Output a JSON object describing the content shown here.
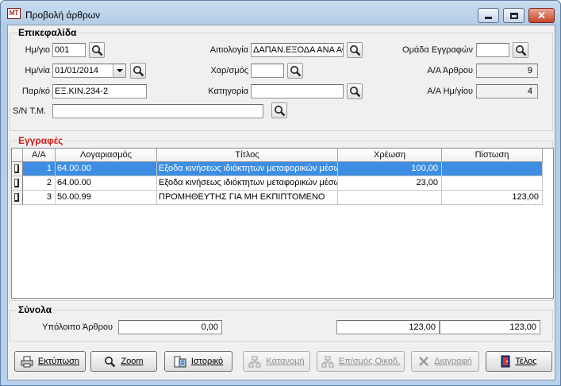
{
  "window": {
    "title": "Προβολή άρθρων",
    "app_icon_text": "ΜΤ"
  },
  "header_group": {
    "label": "Επικεφαλίδα",
    "date_label": "Ημ/γιο",
    "date_value": "001",
    "date2_label": "Ημ/νία",
    "date2_value": "01/01/2014",
    "doc_label": "Παρ/κό",
    "doc_value": "ΕΞ.ΚΙΝ.234-2",
    "serial_label": "S/N Τ.Μ.",
    "serial_value": "",
    "reason_label": "Αιτιολογία",
    "reason_value": "ΔΑΠΑΝ.ΕΞΟΔΑ ΑΝΑ ΑΦ",
    "char_label": "Χαρ/σμός",
    "char_value": "",
    "category_label": "Κατηγορία",
    "category_value": "",
    "group_label": "Ομάδα Εγγραφών",
    "group_value": "",
    "article_no_label": "Α/Α Άρθρου",
    "article_no_value": "9",
    "daily_no_label": "Α/Α Ημ/γίου",
    "daily_no_value": "4"
  },
  "entries_group": {
    "label": "Εγγραφές",
    "columns": [
      "Α/Α",
      "Λογαριασμός",
      "Τίτλος",
      "Χρέωση",
      "Πίστωση"
    ],
    "rows": [
      {
        "aa": "1",
        "account": "64.00.00",
        "title": "Εξοδα κινήσεως ιδιόκτητων μεταφορικών μέσων",
        "debit": "100,00",
        "credit": ""
      },
      {
        "aa": "2",
        "account": "64.00.00",
        "title": "Εξοδα κινήσεως ιδιόκτητων μεταφορικών μέσων",
        "debit": "23,00",
        "credit": ""
      },
      {
        "aa": "3",
        "account": "50.00.99",
        "title": "ΠΡΟΜΗΘΕΥΤΗΣ ΓΙΑ ΜΗ ΕΚΠΙΠΤΟΜΕΝΟ",
        "debit": "",
        "credit": "123,00"
      }
    ]
  },
  "totals_group": {
    "label": "Σύνολα",
    "balance_label": "Υπόλοιπο Άρθρου",
    "balance_value": "0,00",
    "debit_total": "123,00",
    "credit_total": "123,00"
  },
  "buttons": {
    "print": "Εκτύπωση",
    "zoom": "Zoom",
    "history": "Ιστορικό",
    "distribute": "Κατανομή",
    "processing": "Επ/σμός Οικοδ.",
    "delete": "Διαγραφή",
    "end": "Τέλος"
  }
}
